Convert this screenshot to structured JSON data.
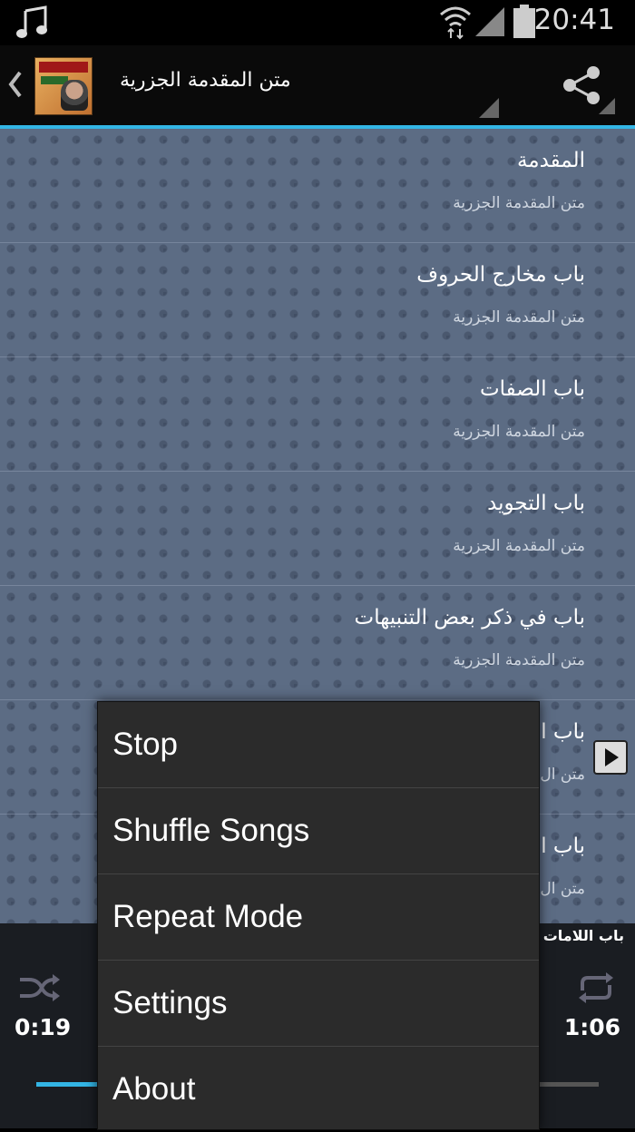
{
  "status_bar": {
    "time": "20:41"
  },
  "action_bar": {
    "title": "متن المقدمة الجزرية"
  },
  "list": {
    "items": [
      {
        "title": "المقدمة",
        "subtitle": "متن المقدمة الجزرية"
      },
      {
        "title": "باب مخارج الحروف",
        "subtitle": "متن المقدمة الجزرية"
      },
      {
        "title": "باب الصفات",
        "subtitle": "متن المقدمة الجزرية"
      },
      {
        "title": "باب التجويد",
        "subtitle": "متن المقدمة الجزرية"
      },
      {
        "title": "باب في ذكر بعض التنبيهات",
        "subtitle": "متن المقدمة الجزرية"
      },
      {
        "title": "باب ا",
        "subtitle": "متن ال"
      },
      {
        "title": "باب ا",
        "subtitle": "متن ال"
      }
    ]
  },
  "player": {
    "now_playing_partial": "باب اللامات و",
    "current_time": "0:19",
    "duration": "1:06",
    "progress_fraction": 0.29
  },
  "menu": {
    "items": [
      "Stop",
      "Shuffle Songs",
      "Repeat Mode",
      "Settings",
      "About"
    ]
  },
  "colors": {
    "accent": "#33b5e5",
    "list_bg": "#5c6c84",
    "menu_bg": "#2b2b2b"
  }
}
